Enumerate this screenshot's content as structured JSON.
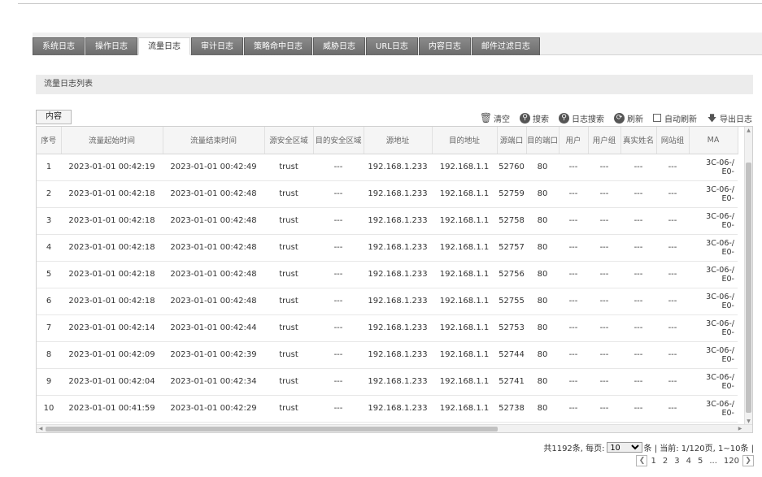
{
  "tabs": [
    "系统日志",
    "操作日志",
    "流量日志",
    "审计日志",
    "策略命中日志",
    "威胁日志",
    "URL日志",
    "内容日志",
    "邮件过滤日志"
  ],
  "active_tab": 2,
  "panel_title": "流量日志列表",
  "content_button": "内容",
  "toolbar": {
    "clear": "清空",
    "search": "搜索",
    "log_search": "日志搜索",
    "refresh": "刷新",
    "auto_refresh": "自动刷新",
    "export": "导出日志"
  },
  "table": {
    "columns": [
      "序号",
      "流量起始时间",
      "流量结束时间",
      "源安全区域",
      "目的安全区域",
      "源地址",
      "目的地址",
      "源端口",
      "目的端口",
      "用户",
      "用户组",
      "真实姓名",
      "网站组",
      "MA"
    ],
    "rows": [
      [
        "1",
        "2023-01-01 00:42:19",
        "2023-01-01 00:42:49",
        "trust",
        "---",
        "192.168.1.233",
        "192.168.1.1",
        "52760",
        "80",
        "---",
        "---",
        "---",
        "---",
        "3C-06-/",
        "E0-"
      ],
      [
        "2",
        "2023-01-01 00:42:18",
        "2023-01-01 00:42:48",
        "trust",
        "---",
        "192.168.1.233",
        "192.168.1.1",
        "52759",
        "80",
        "---",
        "---",
        "---",
        "---",
        "3C-06-/",
        "E0-"
      ],
      [
        "3",
        "2023-01-01 00:42:18",
        "2023-01-01 00:42:48",
        "trust",
        "---",
        "192.168.1.233",
        "192.168.1.1",
        "52758",
        "80",
        "---",
        "---",
        "---",
        "---",
        "3C-06-/",
        "E0-"
      ],
      [
        "4",
        "2023-01-01 00:42:18",
        "2023-01-01 00:42:48",
        "trust",
        "---",
        "192.168.1.233",
        "192.168.1.1",
        "52757",
        "80",
        "---",
        "---",
        "---",
        "---",
        "3C-06-/",
        "E0-"
      ],
      [
        "5",
        "2023-01-01 00:42:18",
        "2023-01-01 00:42:48",
        "trust",
        "---",
        "192.168.1.233",
        "192.168.1.1",
        "52756",
        "80",
        "---",
        "---",
        "---",
        "---",
        "3C-06-/",
        "E0-"
      ],
      [
        "6",
        "2023-01-01 00:42:18",
        "2023-01-01 00:42:48",
        "trust",
        "---",
        "192.168.1.233",
        "192.168.1.1",
        "52755",
        "80",
        "---",
        "---",
        "---",
        "---",
        "3C-06-/",
        "E0-"
      ],
      [
        "7",
        "2023-01-01 00:42:14",
        "2023-01-01 00:42:44",
        "trust",
        "---",
        "192.168.1.233",
        "192.168.1.1",
        "52753",
        "80",
        "---",
        "---",
        "---",
        "---",
        "3C-06-/",
        "E0-"
      ],
      [
        "8",
        "2023-01-01 00:42:09",
        "2023-01-01 00:42:39",
        "trust",
        "---",
        "192.168.1.233",
        "192.168.1.1",
        "52744",
        "80",
        "---",
        "---",
        "---",
        "---",
        "3C-06-/",
        "E0-"
      ],
      [
        "9",
        "2023-01-01 00:42:04",
        "2023-01-01 00:42:34",
        "trust",
        "---",
        "192.168.1.233",
        "192.168.1.1",
        "52741",
        "80",
        "---",
        "---",
        "---",
        "---",
        "3C-06-/",
        "E0-"
      ],
      [
        "10",
        "2023-01-01 00:41:59",
        "2023-01-01 00:42:29",
        "trust",
        "---",
        "192.168.1.233",
        "192.168.1.1",
        "52738",
        "80",
        "---",
        "---",
        "---",
        "---",
        "3C-06-/",
        "E0-"
      ]
    ]
  },
  "pager": {
    "summary": "共1192条, 每页:",
    "page_size": "10",
    "current": "条 | 当前: 1/120页, 1~10条 |",
    "pages": [
      "1",
      "2",
      "3",
      "4",
      "5",
      "...",
      "120"
    ]
  }
}
